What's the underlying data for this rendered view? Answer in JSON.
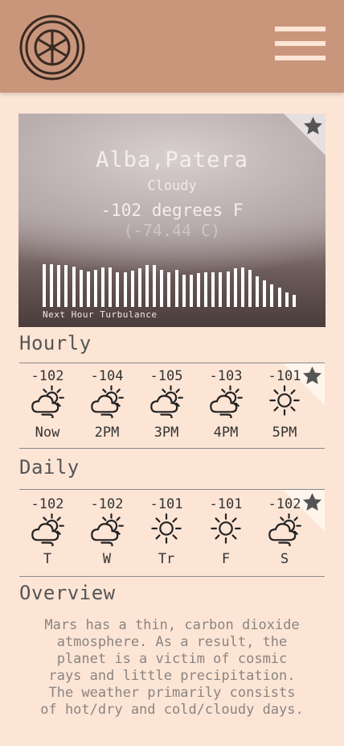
{
  "header": {
    "logo_icon": "ship-wheel-icon",
    "menu_icon": "hamburger-menu-icon"
  },
  "hero": {
    "city": "Alba,Patera",
    "condition": "Cloudy",
    "temp_f": "-102 degrees F",
    "temp_c": "(-74.44 C)",
    "turbulence_label": "Next Hour Turbulance",
    "turbulence_levels": [
      0.98,
      0.98,
      0.96,
      0.96,
      0.92,
      0.86,
      0.82,
      0.86,
      0.9,
      0.9,
      0.8,
      0.8,
      0.84,
      0.88,
      0.96,
      0.96,
      0.86,
      0.8,
      0.86,
      0.74,
      0.74,
      0.78,
      0.8,
      0.8,
      0.8,
      0.82,
      0.88,
      0.9,
      0.86,
      0.7,
      0.62,
      0.52,
      0.44,
      0.34,
      0.28
    ],
    "favorite_icon": "star-icon"
  },
  "hourly": {
    "title": "Hourly",
    "items": [
      {
        "temp": "-102",
        "label": "Now",
        "icon": "cloudy-sun-icon"
      },
      {
        "temp": "-104",
        "label": "2PM",
        "icon": "cloudy-sun-icon"
      },
      {
        "temp": "-105",
        "label": "3PM",
        "icon": "cloudy-sun-icon"
      },
      {
        "temp": "-103",
        "label": "4PM",
        "icon": "cloudy-sun-icon"
      },
      {
        "temp": "-101",
        "label": "5PM",
        "icon": "sun-icon"
      }
    ]
  },
  "daily": {
    "title": "Daily",
    "items": [
      {
        "temp": "-102",
        "label": "T",
        "icon": "cloudy-sun-icon"
      },
      {
        "temp": "-102",
        "label": "W",
        "icon": "cloudy-sun-icon"
      },
      {
        "temp": "-101",
        "label": "Tr",
        "icon": "sun-icon"
      },
      {
        "temp": "-101",
        "label": "F",
        "icon": "sun-icon"
      },
      {
        "temp": "-102",
        "label": "S",
        "icon": "cloudy-sun-icon"
      }
    ]
  },
  "overview": {
    "title": "Overview",
    "text": "Mars has a thin, carbon dioxide\natmosphere. As a result, the\nplanet is a victim of cosmic\nrays and little precipitation.\nThe weather primarily consists\nof hot/dry and cold/cloudy days."
  },
  "colors": {
    "header": "#c9967c",
    "background": "#fde5d6",
    "accent_cream": "#fde5d6"
  }
}
